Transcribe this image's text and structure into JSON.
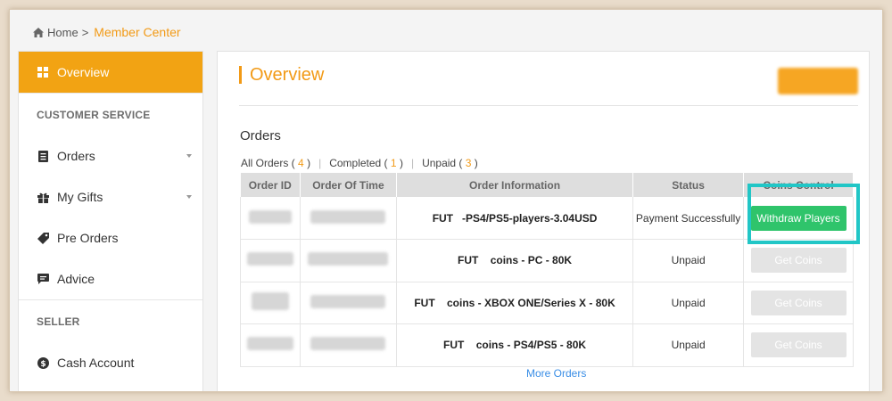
{
  "breadcrumb": {
    "home": "Home",
    "separator": ">",
    "current": "Member Center"
  },
  "sidebar": {
    "overview": "Overview",
    "section_customer_service": "CUSTOMER SERVICE",
    "items": [
      {
        "label": "Orders",
        "icon": "clipboard-icon",
        "has_caret": true
      },
      {
        "label": "My Gifts",
        "icon": "gift-icon",
        "has_caret": true
      },
      {
        "label": "Pre Orders",
        "icon": "tag-icon",
        "has_caret": false
      },
      {
        "label": "Advice",
        "icon": "message-icon",
        "has_caret": false
      }
    ],
    "section_seller": "SELLER",
    "seller_items": [
      {
        "label": "Cash Account",
        "icon": "dollar-icon"
      }
    ]
  },
  "main": {
    "title": "Overview",
    "orders_label": "Orders",
    "filters": {
      "all_label": "All Orders (",
      "all_count": "4",
      "completed_label": "Completed (",
      "completed_count": "1",
      "unpaid_label": "Unpaid (",
      "unpaid_count": "3",
      "close_paren": ")",
      "separator": "|"
    },
    "columns": [
      "Order ID",
      "Order Of Time",
      "Order Information",
      "Status",
      "Coins Control"
    ],
    "rows": [
      {
        "info": "FUT   -PS4/PS5-players-3.04USD",
        "status": "Payment Successfully",
        "action": "Withdraw Players",
        "action_enabled": true
      },
      {
        "info": "FUT    coins - PC - 80K",
        "status": "Unpaid",
        "action": "Get Coins",
        "action_enabled": false
      },
      {
        "info": "FUT    coins - XBOX ONE/Series X - 80K",
        "status": "Unpaid",
        "action": "Get Coins",
        "action_enabled": false
      },
      {
        "info": "FUT    coins - PS4/PS5 - 80K",
        "status": "Unpaid",
        "action": "Get Coins",
        "action_enabled": false
      }
    ],
    "more_orders": "More Orders"
  },
  "colors": {
    "accent": "#f2a313",
    "success": "#2fc46b",
    "highlight": "#21c6c6",
    "link": "#3a8ee6"
  }
}
